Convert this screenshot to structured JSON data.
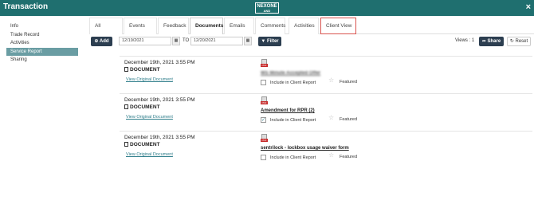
{
  "window": {
    "title": "Transaction",
    "logo": "NEXONE",
    "logo_sub": "AND",
    "close": "×"
  },
  "sidebar": {
    "items": [
      {
        "label": "Info",
        "active": false
      },
      {
        "label": "Trade Record",
        "active": false
      },
      {
        "label": "Activities",
        "active": false
      },
      {
        "label": "Service Report",
        "active": true
      },
      {
        "label": "Sharing",
        "active": false
      }
    ]
  },
  "tabs": [
    {
      "label": "All"
    },
    {
      "label": "Events"
    },
    {
      "label": "Feedback"
    },
    {
      "label": "Documents",
      "active": true
    },
    {
      "label": "Emails"
    },
    {
      "label": "Comments"
    },
    {
      "label": "Activities"
    },
    {
      "label": "Client View",
      "highlight": true
    }
  ],
  "toolbar": {
    "add_label": "Add",
    "date_from": "12/19/2021",
    "to_label": "TO",
    "date_to": "12/20/2021",
    "filter_label": "Filter",
    "views_label": "Views : 1",
    "share_label": "Share",
    "reset_label": "Reset"
  },
  "rows": [
    {
      "date": "December 19th, 2021 3:55 PM",
      "type": "DOCUMENT",
      "view_link": "View Original Document",
      "file_name": "WS Minute Accepted Offer",
      "file_blurred": true,
      "include_label": "Include in Client Report",
      "included": false,
      "featured_label": "Featured"
    },
    {
      "date": "December 19th, 2021 3:55 PM",
      "type": "DOCUMENT",
      "view_link": "View Original Document",
      "file_name": "Amendment for RPR (2)",
      "file_blurred": false,
      "include_label": "Include in Client Report",
      "included": true,
      "featured_label": "Featured"
    },
    {
      "date": "December 19th, 2021 3:55 PM",
      "type": "DOCUMENT",
      "view_link": "View Original Document",
      "file_name": "sentrilock - lockbox usage waiver form",
      "file_blurred": false,
      "include_label": "Include in Client Report",
      "included": false,
      "featured_label": "Featured"
    }
  ],
  "colors": {
    "titlebar": "#1f6f6f",
    "sidebar_active": "#6a9da3",
    "button_dark": "#2c3e50",
    "highlight_border": "#d9534f",
    "link": "#2e7d8a"
  }
}
